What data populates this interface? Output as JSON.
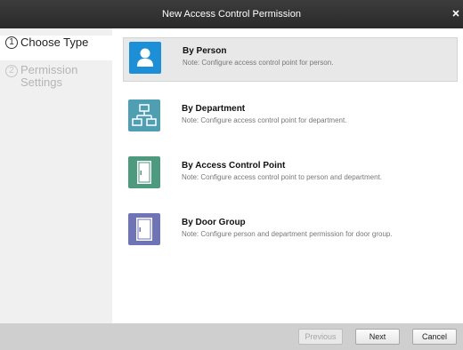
{
  "window": {
    "title": "New Access Control Permission"
  },
  "steps": [
    {
      "number": "1",
      "label": "Choose Type"
    },
    {
      "number": "2",
      "label": "Permission Settings"
    }
  ],
  "options": [
    {
      "title": "By Person",
      "note": "Note: Configure access control point for person.",
      "icon": "person-icon",
      "color": "#1b8fd8"
    },
    {
      "title": "By Department",
      "note": "Note: Configure access control point for department.",
      "icon": "department-icon",
      "color": "#4e9fb1"
    },
    {
      "title": "By Access Control Point",
      "note": "Note: Configure access control point to person and department.",
      "icon": "door-icon",
      "color": "#4d9a7e"
    },
    {
      "title": "By Door Group",
      "note": "Note: Configure person and department permission for door group.",
      "icon": "door-group-icon",
      "color": "#6f74b8"
    }
  ],
  "footer": {
    "previous": "Previous",
    "next": "Next",
    "cancel": "Cancel"
  }
}
